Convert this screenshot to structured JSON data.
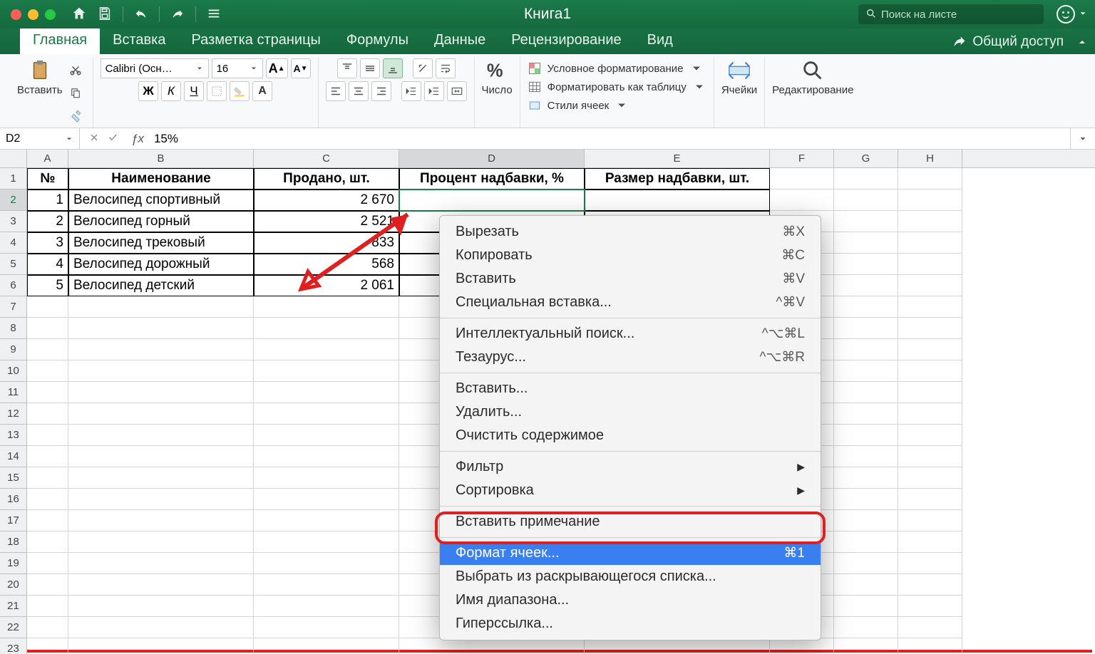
{
  "titlebar": {
    "title": "Книга1",
    "search_placeholder": "Поиск на листе"
  },
  "tabs": {
    "t0": "Главная",
    "t1": "Вставка",
    "t2": "Разметка страницы",
    "t3": "Формулы",
    "t4": "Данные",
    "t5": "Рецензирование",
    "t6": "Вид",
    "share": "Общий доступ"
  },
  "ribbon": {
    "paste": "Вставить",
    "font_name": "Calibri (Осн…",
    "font_size": "16",
    "number": "Число",
    "cond": "Условное форматирование",
    "astable": "Форматировать как таблицу",
    "styles": "Стили ячеек",
    "cells": "Ячейки",
    "editing": "Редактирование",
    "bold": "Ж",
    "italic": "К",
    "underline": "Ч",
    "bigA": "A",
    "smA": "A"
  },
  "namebox": {
    "ref": "D2",
    "formula": "15%"
  },
  "columns": {
    "A": "A",
    "B": "B",
    "C": "C",
    "D": "D",
    "E": "E",
    "F": "F",
    "G": "G",
    "H": "H"
  },
  "headers": {
    "num": "№",
    "name": "Наименование",
    "sold": "Продано, шт.",
    "markup_pct": "Процент надбавки, %",
    "markup_size": "Размер надбавки, шт."
  },
  "rows": [
    {
      "n": "1",
      "name": "Велосипед спортивный",
      "sold": "2 670"
    },
    {
      "n": "2",
      "name": "Велосипед горный",
      "sold": "2 521"
    },
    {
      "n": "3",
      "name": "Велосипед трековый",
      "sold": "833"
    },
    {
      "n": "4",
      "name": "Велосипед дорожный",
      "sold": "568"
    },
    {
      "n": "5",
      "name": "Велосипед детский",
      "sold": "2 061"
    }
  ],
  "rowlabels": [
    "1",
    "2",
    "3",
    "4",
    "5",
    "6",
    "7",
    "8",
    "9",
    "10",
    "11",
    "12",
    "13",
    "14",
    "15",
    "16",
    "17",
    "18",
    "19",
    "20",
    "21",
    "22",
    "23"
  ],
  "ctx": {
    "cut": "Вырезать",
    "cut_k": "⌘X",
    "copy": "Копировать",
    "copy_k": "⌘C",
    "paste": "Вставить",
    "paste_k": "⌘V",
    "pspecial": "Специальная вставка...",
    "pspecial_k": "^⌘V",
    "smartlookup": "Интеллектуальный поиск...",
    "smartlookup_k": "^⌥⌘L",
    "thesaurus": "Тезаурус...",
    "thesaurus_k": "^⌥⌘R",
    "insert": "Вставить...",
    "delete": "Удалить...",
    "clear": "Очистить содержимое",
    "filter": "Фильтр",
    "sort": "Сортировка",
    "comment": "Вставить примечание",
    "format": "Формат ячеек...",
    "format_k": "⌘1",
    "dropdown": "Выбрать из раскрывающегося списка...",
    "rangename": "Имя диапазона...",
    "hyperlink": "Гиперссылка..."
  }
}
